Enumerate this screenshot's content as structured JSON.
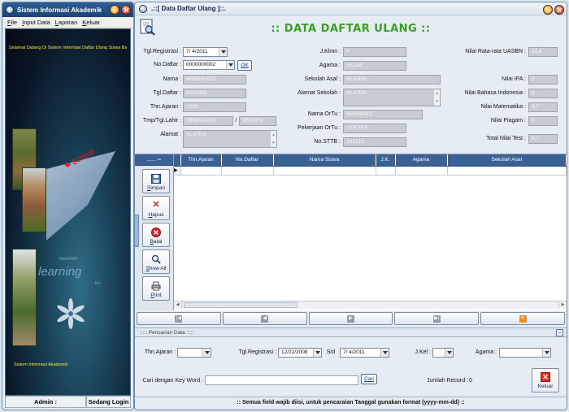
{
  "left_window": {
    "title": "Sistem Informasi Akademik",
    "menu": [
      "File",
      "Input Data",
      "Laporan",
      "Keluar"
    ],
    "ticker": "Selamat Datang Di Sistem Informasi Daftar Ulang Siswa Baru",
    "bottom_text": "Sistem Informasi Akademik",
    "status_admin": "Admin :",
    "status_login": "Sedang Login",
    "decor": {
      "school": "School",
      "learning": "learning",
      "teachers": "teachers",
      "fun": "fun"
    }
  },
  "right_window": {
    "title": ".::[ Data Daftar Ulang ]::.",
    "page_title": ":: DATA DAFTAR ULANG ::",
    "form": {
      "tgl_registrasi_label": "Tgl.Registrasi :",
      "tgl_registrasi_value": "7/ 4/2011",
      "no_daftar_label": "No.Daftar :",
      "no_daftar_value": "0000000002",
      "ok_label": "OK",
      "nama_label": "Nama :",
      "nama_value": "WINDIRATO",
      "tgl_daftar_label": "Tgl.Daftar :",
      "tgl_daftar_value": "6/9/2009",
      "thn_ajaran_label": "Thn.Ajaran :",
      "thn_ajaran_value": "2009",
      "tmp_tgl_lahir_label": "Tmp/Tgl.Lahir :",
      "tmp_lahir_value": "SEMARANG",
      "tgl_lahir_separator": "/",
      "tgl_lahir_value": "6/9/2009",
      "alamat_label": "Alamat :",
      "alamat_value": "KLATEN",
      "jklmn_label": "J.Klmn :",
      "jklmn_value": "P",
      "agama_label": "Agama :",
      "agama_value": "ISLAM",
      "sekolah_asal_label": "Sekolah Asal :",
      "sekolah_asal_value": "KLATEN",
      "alamat_sekolah_label": "Alamat Sekolah :",
      "alamat_sekolah_value": "KLATEN",
      "nama_ortu_label": "Nama OrTu :",
      "nama_ortu_value": "SUDARNO",
      "pekerjaan_ortu_label": "Pekerjaan OrTu :",
      "pekerjaan_ortu_value": "DOKTER",
      "no_sttb_label": "No.STTB :",
      "no_sttb_value": "121212",
      "uasbn_label": "Nilai Rata-rata UASBN :",
      "uasbn_value": "31,4",
      "ipa_label": "Nilai IPA :",
      "ipa_value": "8",
      "bindo_label": "Nilai Bahasa Indonesia :",
      "bindo_value": "8",
      "mtk_label": "Nilai Matematika :",
      "mtk_value": "8,7",
      "piagam_label": "Nilai Piagam :",
      "piagam_value": "0",
      "total_test_label": "Total Nilai Test :",
      "total_test_value": "6,7"
    },
    "sidebar": {
      "header": "......",
      "buttons": [
        "Simpan",
        "Hapus",
        "Batal",
        "Show All",
        "Print"
      ]
    },
    "grid": {
      "columns": [
        "Thn.Ajaran",
        "No.Daftar",
        "Nama Siswa",
        "J.K.",
        "Agama",
        "Sekolah Asal"
      ]
    },
    "search": {
      "header": "::::: Pencarian Data :::::",
      "thn_ajaran_label": "Thn.Ajaran :",
      "tgl_registrasi_label": "Tgl.Registrasi :",
      "tgl_from": "12/22/2008",
      "sd_label": "S/d",
      "tgl_to": "7/ 4/2011",
      "jkel_label": "J.Kel :",
      "agama_label": "Agama :",
      "keyword_label": "Cari dengan Key Word :",
      "cari_label": "Cari",
      "jumlah_label": "Jumlah Record :",
      "jumlah_value": "0",
      "keluar_label": "Keluar"
    },
    "footer": ":: Semua field wajib diisi, untuk pencaraian Tanggal gunakan format (yyyy-mm-dd) ::"
  }
}
